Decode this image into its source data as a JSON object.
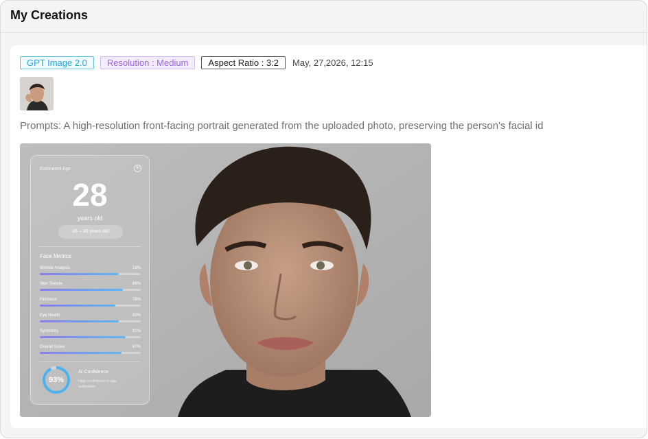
{
  "header": {
    "title": "My Creations"
  },
  "meta": {
    "model": "GPT Image 2.0",
    "resolution": "Resolution : Medium",
    "aspect_ratio": "Aspect Ratio : 3:2",
    "timestamp": "May, 27,2026, 12:15"
  },
  "prompt": {
    "text": "Prompts: A high-resolution front-facing portrait generated from the uploaded photo, preserving the person's facial id"
  },
  "result": {
    "estimated_age_label": "Estimated Age",
    "ai_badge": "AI",
    "age": "28",
    "age_unit": "years old",
    "age_range": "26 – 30 years old",
    "metrics_title": "Face Metrics",
    "metrics": [
      {
        "name": "Wrinkle Analysis",
        "value": "18%",
        "fill": 0.78
      },
      {
        "name": "Skin Texture",
        "value": "86%",
        "fill": 0.82
      },
      {
        "name": "Firmness",
        "value": "78%",
        "fill": 0.75
      },
      {
        "name": "Eye Health",
        "value": "83%",
        "fill": 0.78
      },
      {
        "name": "Symmetry",
        "value": "91%",
        "fill": 0.85
      },
      {
        "name": "Overall Score",
        "value": "87%",
        "fill": 0.81
      }
    ],
    "confidence": "93%",
    "confidence_title": "AI Confidence",
    "confidence_desc": "High confidence in age estimation"
  }
}
